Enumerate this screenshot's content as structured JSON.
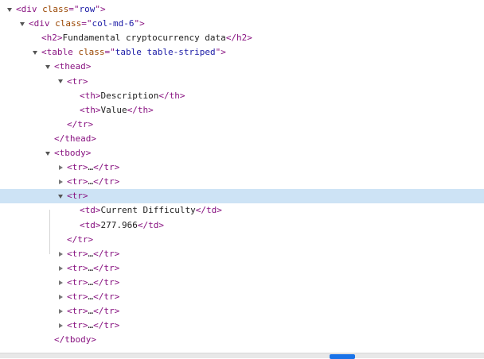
{
  "colors": {
    "tag": "#881280",
    "attr_name": "#994500",
    "attr_value": "#1a1aa6",
    "text": "#222222",
    "selected_row": "#cde3f5",
    "scroll_thumb": "#1a73e8"
  },
  "nodes": [
    {
      "name": "dom-node-div-row",
      "depth": 0,
      "toggle": "expanded",
      "selected": false,
      "parts": [
        {
          "t": "tag",
          "v": "<div "
        },
        {
          "t": "attr",
          "v": "class"
        },
        {
          "t": "tag",
          "v": "=\""
        },
        {
          "t": "val",
          "v": "row"
        },
        {
          "t": "tag",
          "v": "\">"
        }
      ]
    },
    {
      "name": "dom-node-div-col-md-6",
      "depth": 1,
      "toggle": "expanded",
      "selected": false,
      "parts": [
        {
          "t": "tag",
          "v": "<div "
        },
        {
          "t": "attr",
          "v": "class"
        },
        {
          "t": "tag",
          "v": "=\""
        },
        {
          "t": "val",
          "v": "col-md-6"
        },
        {
          "t": "tag",
          "v": "\">"
        }
      ]
    },
    {
      "name": "dom-node-h2",
      "depth": 2,
      "toggle": "none",
      "selected": false,
      "parts": [
        {
          "t": "tag",
          "v": "<h2>"
        },
        {
          "t": "txt",
          "v": "Fundamental cryptocurrency data"
        },
        {
          "t": "tag",
          "v": "</h2>"
        }
      ]
    },
    {
      "name": "dom-node-table",
      "depth": 2,
      "toggle": "expanded",
      "selected": false,
      "parts": [
        {
          "t": "tag",
          "v": "<table "
        },
        {
          "t": "attr",
          "v": "class"
        },
        {
          "t": "tag",
          "v": "=\""
        },
        {
          "t": "val",
          "v": "table table-striped"
        },
        {
          "t": "tag",
          "v": "\">"
        }
      ]
    },
    {
      "name": "dom-node-thead",
      "depth": 3,
      "toggle": "expanded",
      "selected": false,
      "parts": [
        {
          "t": "tag",
          "v": "<thead>"
        }
      ]
    },
    {
      "name": "dom-node-thead-tr",
      "depth": 4,
      "toggle": "expanded",
      "selected": false,
      "parts": [
        {
          "t": "tag",
          "v": "<tr>"
        }
      ]
    },
    {
      "name": "dom-node-th-description",
      "depth": 5,
      "toggle": "none",
      "selected": false,
      "parts": [
        {
          "t": "tag",
          "v": "<th>"
        },
        {
          "t": "txt",
          "v": "Description"
        },
        {
          "t": "tag",
          "v": "</th>"
        }
      ]
    },
    {
      "name": "dom-node-th-value",
      "depth": 5,
      "toggle": "none",
      "selected": false,
      "parts": [
        {
          "t": "tag",
          "v": "<th>"
        },
        {
          "t": "txt",
          "v": "Value"
        },
        {
          "t": "tag",
          "v": "</th>"
        }
      ]
    },
    {
      "name": "dom-node-thead-tr-close",
      "depth": 4,
      "toggle": "none",
      "selected": false,
      "parts": [
        {
          "t": "tag",
          "v": "</tr>"
        }
      ]
    },
    {
      "name": "dom-node-thead-close",
      "depth": 3,
      "toggle": "none",
      "selected": false,
      "parts": [
        {
          "t": "tag",
          "v": "</thead>"
        }
      ]
    },
    {
      "name": "dom-node-tbody",
      "depth": 3,
      "toggle": "expanded",
      "selected": false,
      "parts": [
        {
          "t": "tag",
          "v": "<tbody>"
        }
      ]
    },
    {
      "name": "dom-node-tbody-tr-1",
      "depth": 4,
      "toggle": "collapsed",
      "selected": false,
      "parts": [
        {
          "t": "tag",
          "v": "<tr>"
        },
        {
          "t": "txt",
          "v": "…"
        },
        {
          "t": "tag",
          "v": "</tr>"
        }
      ]
    },
    {
      "name": "dom-node-tbody-tr-2",
      "depth": 4,
      "toggle": "collapsed",
      "selected": false,
      "parts": [
        {
          "t": "tag",
          "v": "<tr>"
        },
        {
          "t": "txt",
          "v": "…"
        },
        {
          "t": "tag",
          "v": "</tr>"
        }
      ]
    },
    {
      "name": "dom-node-tbody-tr-selected",
      "depth": 4,
      "toggle": "expanded",
      "selected": true,
      "parts": [
        {
          "t": "tag",
          "v": "<tr>"
        }
      ]
    },
    {
      "name": "dom-node-td-current-difficulty",
      "depth": 5,
      "toggle": "none",
      "selected": false,
      "parts": [
        {
          "t": "tag",
          "v": "<td>"
        },
        {
          "t": "txt",
          "v": "Current Difficulty"
        },
        {
          "t": "tag",
          "v": "</td>"
        }
      ]
    },
    {
      "name": "dom-node-td-value",
      "depth": 5,
      "toggle": "none",
      "selected": false,
      "parts": [
        {
          "t": "tag",
          "v": "<td>"
        },
        {
          "t": "txt",
          "v": "277.966"
        },
        {
          "t": "tag",
          "v": "</td>"
        }
      ]
    },
    {
      "name": "dom-node-tbody-tr-selected-close",
      "depth": 4,
      "toggle": "none",
      "selected": false,
      "parts": [
        {
          "t": "tag",
          "v": "</tr>"
        }
      ]
    },
    {
      "name": "dom-node-tbody-tr-4",
      "depth": 4,
      "toggle": "collapsed",
      "selected": false,
      "parts": [
        {
          "t": "tag",
          "v": "<tr>"
        },
        {
          "t": "txt",
          "v": "…"
        },
        {
          "t": "tag",
          "v": "</tr>"
        }
      ]
    },
    {
      "name": "dom-node-tbody-tr-5",
      "depth": 4,
      "toggle": "collapsed",
      "selected": false,
      "parts": [
        {
          "t": "tag",
          "v": "<tr>"
        },
        {
          "t": "txt",
          "v": "…"
        },
        {
          "t": "tag",
          "v": "</tr>"
        }
      ]
    },
    {
      "name": "dom-node-tbody-tr-6",
      "depth": 4,
      "toggle": "collapsed",
      "selected": false,
      "parts": [
        {
          "t": "tag",
          "v": "<tr>"
        },
        {
          "t": "txt",
          "v": "…"
        },
        {
          "t": "tag",
          "v": "</tr>"
        }
      ]
    },
    {
      "name": "dom-node-tbody-tr-7",
      "depth": 4,
      "toggle": "collapsed",
      "selected": false,
      "parts": [
        {
          "t": "tag",
          "v": "<tr>"
        },
        {
          "t": "txt",
          "v": "…"
        },
        {
          "t": "tag",
          "v": "</tr>"
        }
      ]
    },
    {
      "name": "dom-node-tbody-tr-8",
      "depth": 4,
      "toggle": "collapsed",
      "selected": false,
      "parts": [
        {
          "t": "tag",
          "v": "<tr>"
        },
        {
          "t": "txt",
          "v": "…"
        },
        {
          "t": "tag",
          "v": "</tr>"
        }
      ]
    },
    {
      "name": "dom-node-tbody-tr-9",
      "depth": 4,
      "toggle": "collapsed",
      "selected": false,
      "parts": [
        {
          "t": "tag",
          "v": "<tr>"
        },
        {
          "t": "txt",
          "v": "…"
        },
        {
          "t": "tag",
          "v": "</tr>"
        }
      ]
    },
    {
      "name": "dom-node-tbody-close",
      "depth": 3,
      "toggle": "none",
      "selected": false,
      "parts": [
        {
          "t": "tag",
          "v": "</tbody>"
        }
      ]
    }
  ]
}
